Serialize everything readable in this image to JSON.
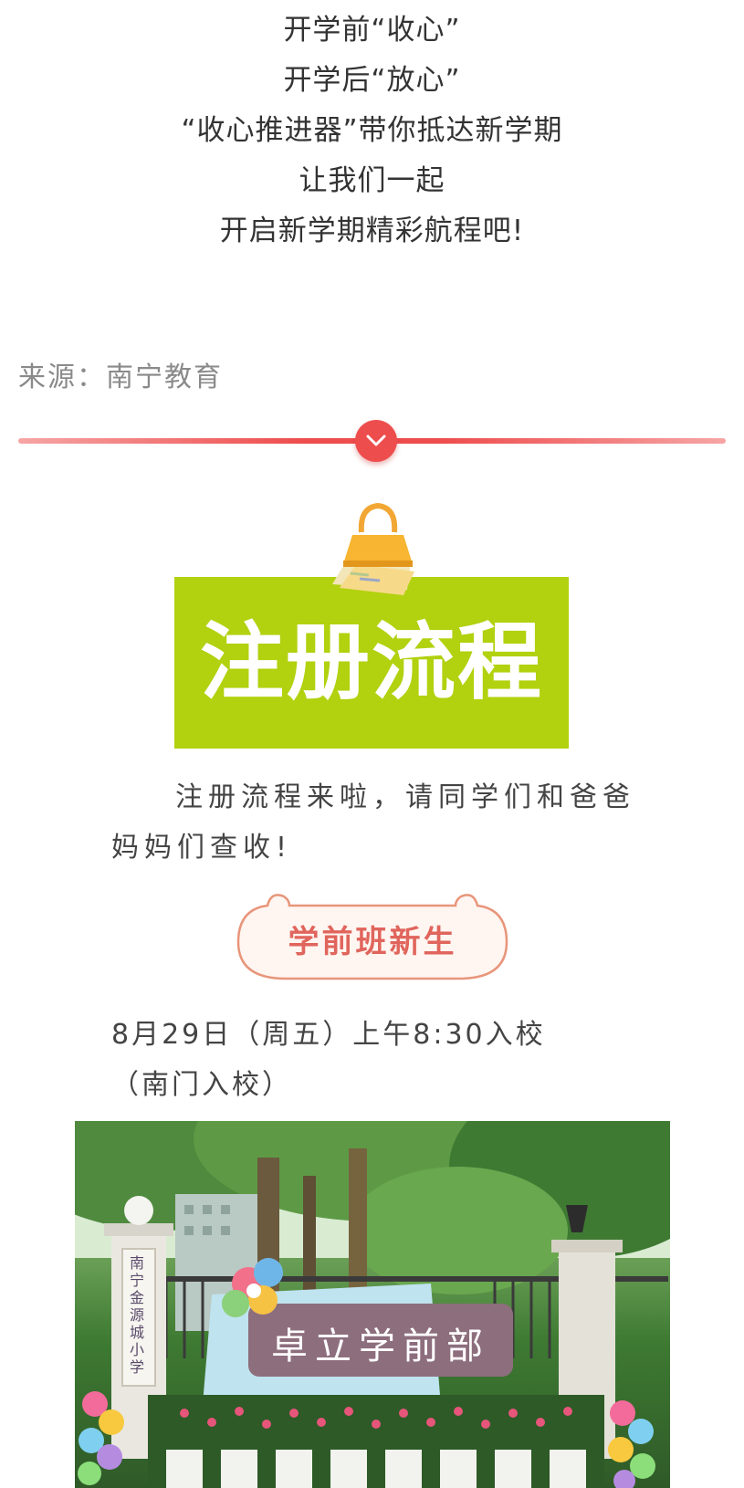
{
  "intro": {
    "lines": [
      "开学前“收心”",
      "开学后“放心”",
      "“收心推进器”带你抵达新学期",
      "让我们一起",
      "开启新学期精彩航程吧!"
    ]
  },
  "source": "来源：南宁教育",
  "section_title": "注册流程",
  "paragraph": "注册流程来啦，请同学们和爸爸妈妈们查收!",
  "badge": "学前班新生",
  "schedule": {
    "line1": "8月29日（周五）上午8:30入校",
    "line2": "（南门入校）"
  },
  "photo": {
    "sign_text": "卓立学前部",
    "pillar_text": "南宁金源城小学"
  },
  "colors": {
    "divider": "#ee4d4d",
    "title_bg": "#b2d10f",
    "badge_text": "#e0655c",
    "badge_border": "#e8957a"
  }
}
